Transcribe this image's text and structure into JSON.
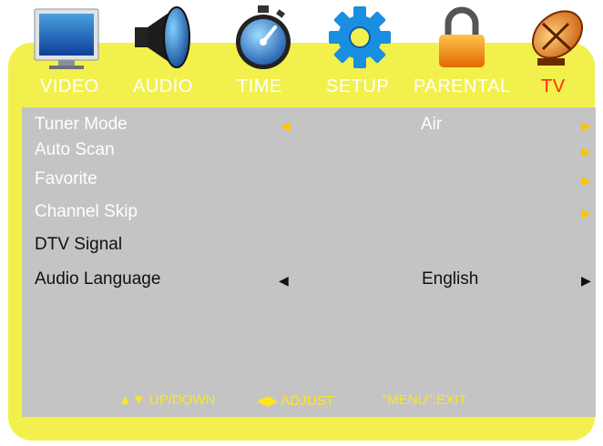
{
  "tabs": [
    {
      "label": "VIDEO",
      "icon": "monitor-icon"
    },
    {
      "label": "AUDIO",
      "icon": "speaker-icon"
    },
    {
      "label": "TIME",
      "icon": "stopwatch-icon"
    },
    {
      "label": "SETUP",
      "icon": "gear-icon"
    },
    {
      "label": "PARENTAL",
      "icon": "padlock-icon"
    },
    {
      "label": "TV",
      "icon": "satellite-dish-icon"
    }
  ],
  "active_tab": "TV",
  "menu": {
    "tuner_mode": {
      "label": "Tuner Mode",
      "value": "Air"
    },
    "auto_scan": {
      "label": "Auto Scan"
    },
    "favorite": {
      "label": "Favorite"
    },
    "channel_skip": {
      "label": "Channel Skip"
    },
    "dtv_signal": {
      "label": "DTV Signal"
    },
    "audio_language": {
      "label": "Audio Language",
      "value": "English"
    }
  },
  "hints": {
    "updown": "UP/DOWN",
    "adjust": "ADJUST",
    "exit": "\"MENU\":EXIT"
  },
  "colors": {
    "panel": "#f2f04c",
    "content": "#c4c4c4",
    "active_tab": "#ff2a10",
    "arrow": "#ffc400"
  }
}
